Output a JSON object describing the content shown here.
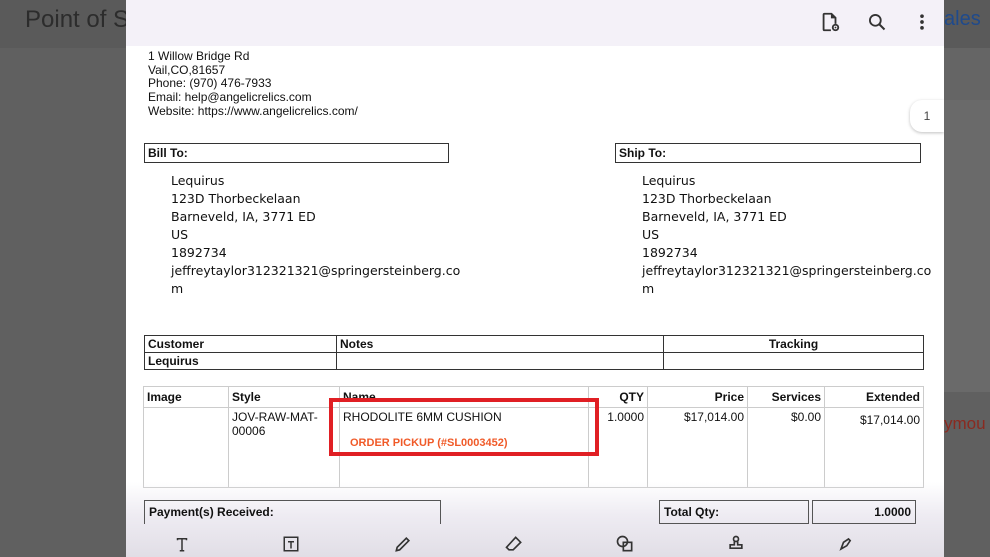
{
  "background": {
    "app_title": "Point of S",
    "right_link": "ales",
    "right_text": "ymou"
  },
  "viewer": {
    "icons": [
      "file-settings-icon",
      "search-icon",
      "more-vert-icon"
    ],
    "page_number": "1"
  },
  "company": {
    "address": "1 Willow Bridge Rd",
    "city": "Vail,CO,81657",
    "phone": "Phone: (970) 476-7933",
    "email": "Email: help@angelicrelics.com",
    "website": "Website: https://www.angelicrelics.com/"
  },
  "bill_to": {
    "label": "Bill To:",
    "lines": [
      "Lequirus",
      "123D Thorbeckelaan",
      "Barneveld, IA, 3771 ED",
      "US",
      "1892734",
      "jeffreytaylor312321321@springersteinberg.co",
      "m"
    ]
  },
  "ship_to": {
    "label": "Ship To:",
    "lines": [
      "Lequirus",
      "123D Thorbeckelaan",
      "Barneveld, IA, 3771 ED",
      "US",
      "1892734",
      "jeffreytaylor312321321@springersteinberg.co",
      "m"
    ]
  },
  "info_table": {
    "headers": {
      "customer": "Customer",
      "notes": "Notes",
      "tracking": "Tracking"
    },
    "customer": "Lequirus"
  },
  "items": {
    "headers": {
      "image": "Image",
      "style": "Style",
      "name": "Name",
      "qty": "QTY",
      "price": "Price",
      "services": "Services",
      "extended": "Extended"
    },
    "row": {
      "style_line1": "JOV-RAW-MAT-",
      "style_line2": "00006",
      "name": "RHODOLITE 6MM CUSHION",
      "note": "ORDER PICKUP (#SL0003452)",
      "qty": "1.0000",
      "price": "$17,014.00",
      "services": "$0.00",
      "extended": "$17,014.00"
    }
  },
  "totals": {
    "payments_label": "Payment(s) Received:",
    "total_qty_label": "Total Qty:",
    "total_qty_value": "1.0000"
  },
  "colors": {
    "highlight": "#e01f24",
    "pickup_text": "#f05a28",
    "toolbar_bg": "#f4f1f8"
  },
  "bottom_tools": [
    "text-icon",
    "text-box-icon",
    "draw-icon",
    "eraser-icon",
    "shape-icon",
    "stamp-icon",
    "signature-icon"
  ]
}
